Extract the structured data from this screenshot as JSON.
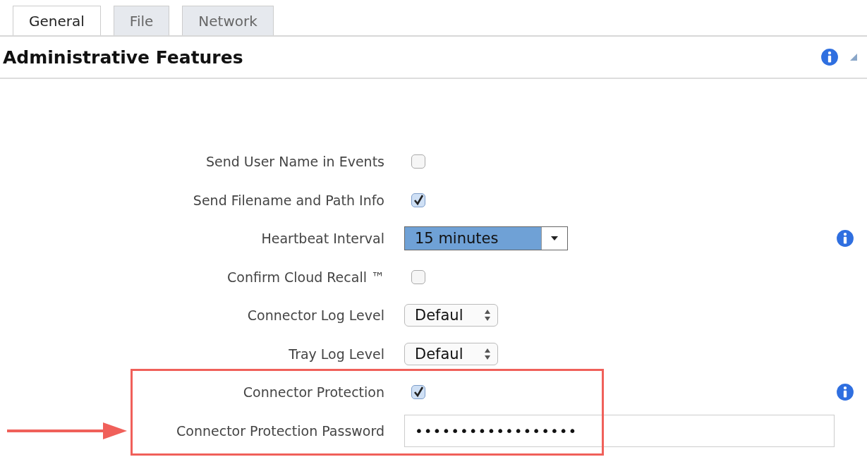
{
  "tabs": [
    {
      "label": "General",
      "selected": true
    },
    {
      "label": "File",
      "selected": false
    },
    {
      "label": "Network",
      "selected": false
    }
  ],
  "section": {
    "title": "Administrative Features"
  },
  "rows": [
    {
      "label": "Send User Name in Events",
      "kind": "checkbox",
      "checked": false,
      "info": false,
      "highlighted": false
    },
    {
      "label": "Send Filename and Path Info",
      "kind": "checkbox",
      "checked": true,
      "info": false,
      "highlighted": false
    },
    {
      "label": "Heartbeat Interval",
      "kind": "dropdown",
      "value": "15 minutes",
      "info": true,
      "highlighted": false
    },
    {
      "label": "Confirm Cloud Recall ™",
      "kind": "checkbox",
      "checked": false,
      "info": false,
      "highlighted": false
    },
    {
      "label": "Connector Log Level",
      "kind": "stepper",
      "value": "Defaul",
      "info": false,
      "highlighted": false
    },
    {
      "label": "Tray Log Level",
      "kind": "stepper",
      "value": "Defaul",
      "info": false,
      "highlighted": false
    },
    {
      "label": "Connector Protection",
      "kind": "checkbox",
      "checked": true,
      "info": true,
      "highlighted": true
    },
    {
      "label": "Connector Protection Password",
      "kind": "password",
      "value": "••••••••••••••••••",
      "info": false,
      "highlighted": true
    }
  ]
}
